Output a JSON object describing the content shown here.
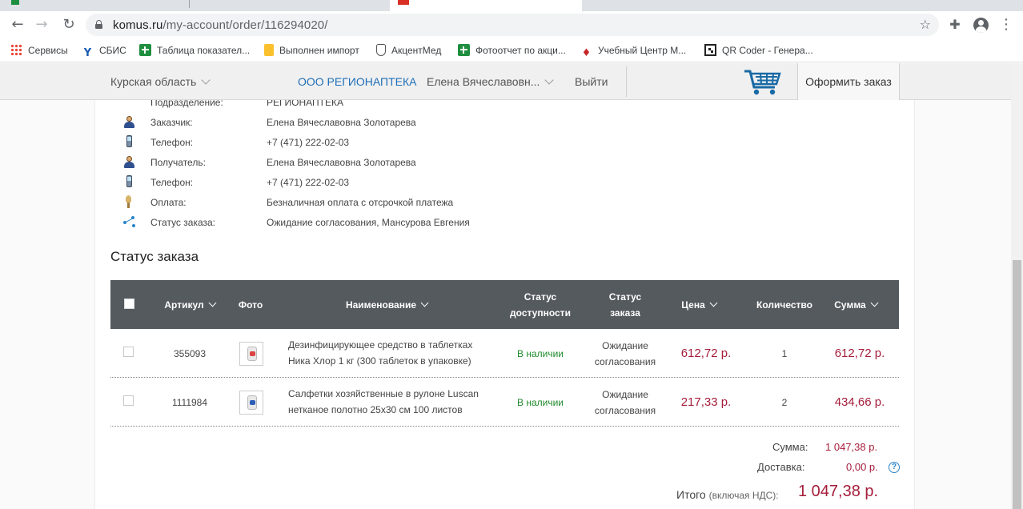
{
  "browser": {
    "url_host": "komus.ru",
    "url_path": "/my-account/order/116294020/"
  },
  "bookmarks": [
    {
      "label": "Сервисы",
      "icon": "apps-grid-icon"
    },
    {
      "label": "СБИС",
      "icon": "sbis-icon"
    },
    {
      "label": "Таблица показател...",
      "icon": "google-sheets-icon"
    },
    {
      "label": "Выполнен импорт",
      "icon": "note-icon"
    },
    {
      "label": "АкцентМед",
      "icon": "akcentmed-icon"
    },
    {
      "label": "Фотоотчет по акци...",
      "icon": "google-sheets-icon"
    },
    {
      "label": "Учебный Центр М...",
      "icon": "graduation-cap-icon"
    },
    {
      "label": "QR Coder - Генера...",
      "icon": "qr-code-icon"
    }
  ],
  "site_header": {
    "region": "Курская область",
    "company": "ООО РЕГИОНАПТЕКА",
    "user": "Елена Вячеславовн...",
    "logout": "Выйти",
    "checkout": "Оформить заказ",
    "link_color": "#1f6fb7"
  },
  "order_info": [
    {
      "label": "Подразделение:",
      "value": "РЕГИОНАПТЕКА",
      "icon": "division-icon"
    },
    {
      "label": "Заказчик:",
      "value": "Елена Вячеславовна Золотарева",
      "icon": "person-icon"
    },
    {
      "label": "Телефон:",
      "value": "+7 (471) 222-02-03",
      "icon": "phone-icon"
    },
    {
      "label": "Получатель:",
      "value": "Елена Вячеславовна Золотарева",
      "icon": "person-icon"
    },
    {
      "label": "Телефон:",
      "value": "+7 (471) 222-02-03",
      "icon": "phone-icon"
    },
    {
      "label": "Оплата:",
      "value": "Безналичная оплата с отсрочкой платежа",
      "icon": "payment-icon"
    },
    {
      "label": "Статус заказа:",
      "value": "Ожидание согласования, Мансурова Евгения",
      "icon": "status-icon"
    }
  ],
  "section_title": "Статус заказа",
  "table": {
    "headers": {
      "article": "Артикул",
      "photo": "Фото",
      "name": "Наименование",
      "availability_line1": "Статус",
      "availability_line2": "доступности",
      "status_line1": "Статус",
      "status_line2": "заказа",
      "price": "Цена",
      "quantity": "Количество",
      "sum": "Сумма"
    },
    "rows": [
      {
        "article": "355093",
        "name_line1": "Дезинфицирующее средство в таблетках",
        "name_line2": "Ника Хлор 1 кг (300 таблеток в упаковке)",
        "availability": "В наличии",
        "status_line1": "Ожидание",
        "status_line2": "согласования",
        "price": "612,72 р.",
        "quantity": "1",
        "sum": "612,72 р."
      },
      {
        "article": "1111984",
        "name_line1": "Салфетки хозяйственные в рулоне Luscan",
        "name_line2": "нетканое полотно 25х30 см 100 листов",
        "availability": "В наличии",
        "status_line1": "Ожидание",
        "status_line2": "согласования",
        "price": "217,33 р.",
        "quantity": "2",
        "sum": "434,66 р."
      }
    ]
  },
  "totals": {
    "sum_label": "Сумма:",
    "sum_value": "1 047,38 р.",
    "delivery_label": "Доставка:",
    "delivery_value": "0,00 р.",
    "help_symbol": "?",
    "grand_label": "Итого",
    "grand_note": "(включая НДС):",
    "grand_value": "1 047,38 р."
  },
  "colors": {
    "accent_price": "#a51d3b",
    "available": "#1f8a2c",
    "table_header": "#555a5f"
  }
}
